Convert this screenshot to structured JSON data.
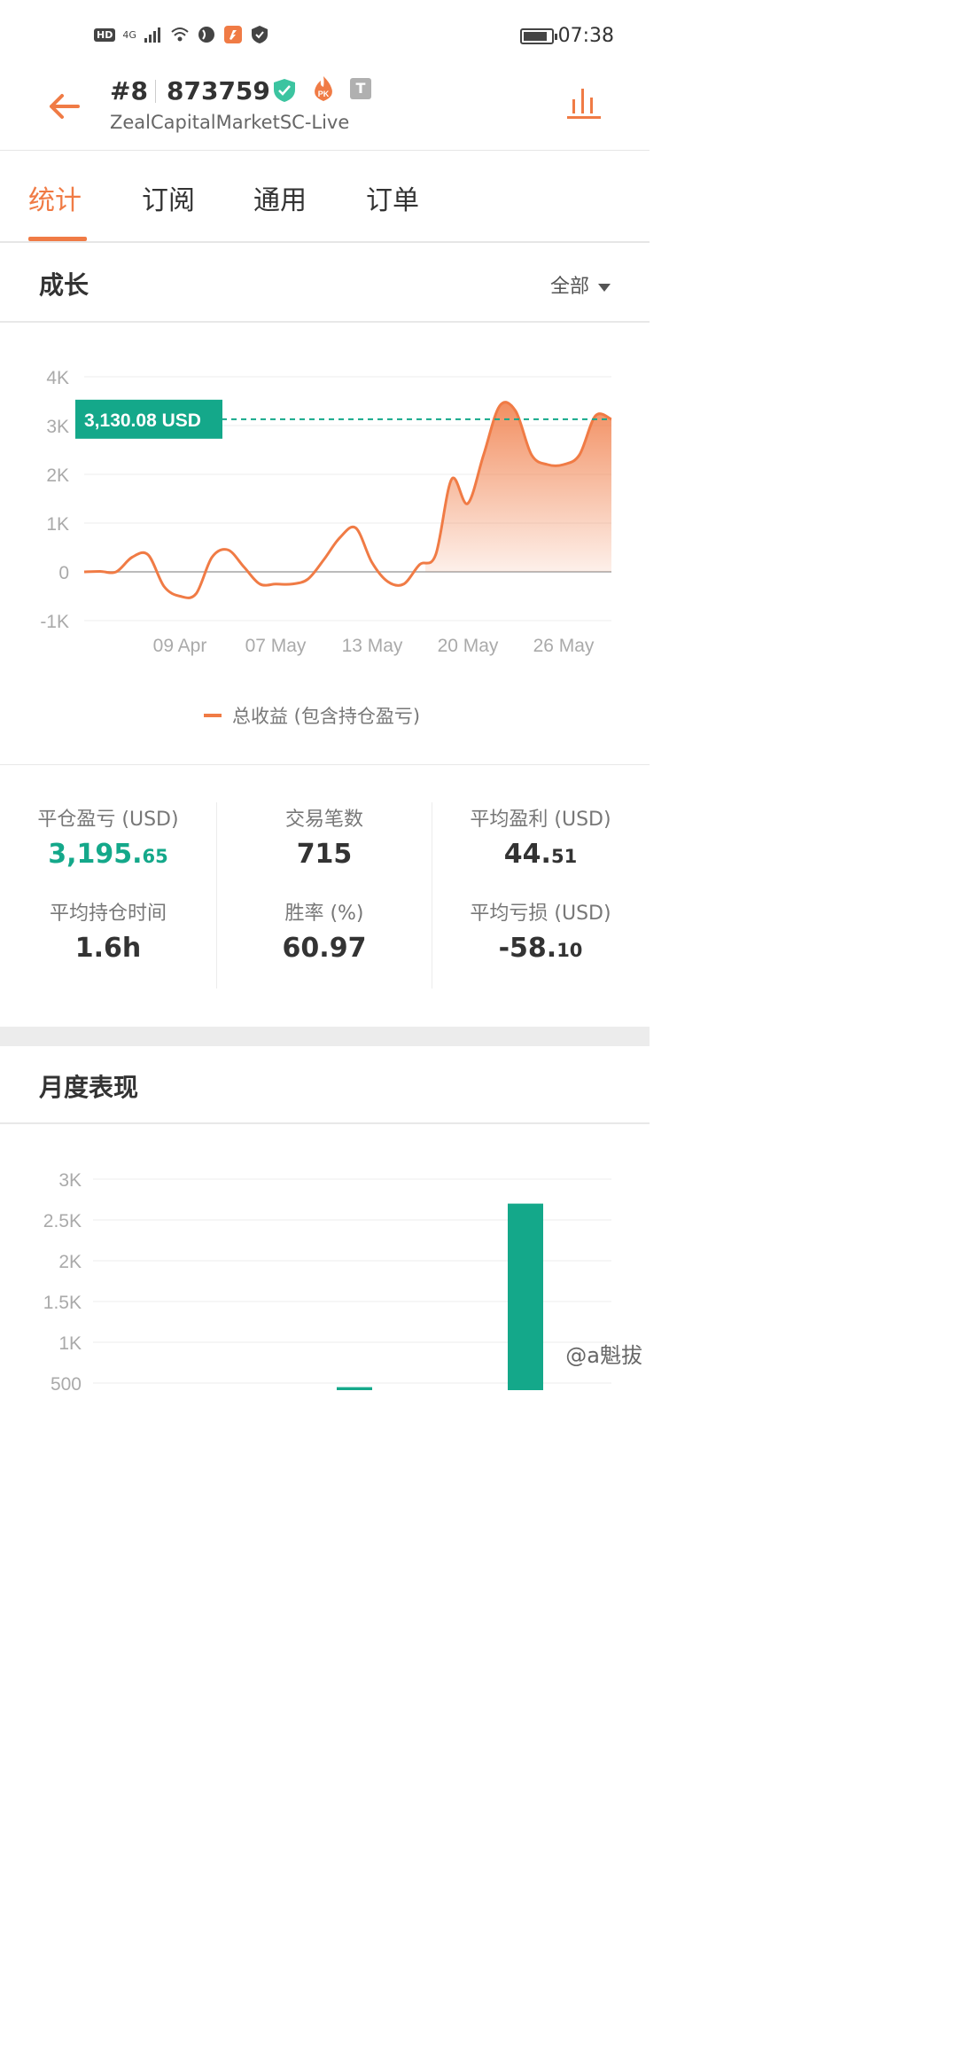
{
  "status_bar": {
    "hd": "HD",
    "network": "4G",
    "time": "07:38",
    "battery_level": 0.85
  },
  "header": {
    "rank": "#8",
    "account_number": "873759",
    "server": "ZealCapitalMarketSC-Live",
    "badge_pk": "PK",
    "badge_t": "T"
  },
  "tabs": [
    {
      "label": "统计",
      "active": true
    },
    {
      "label": "订阅",
      "active": false
    },
    {
      "label": "通用",
      "active": false
    },
    {
      "label": "订单",
      "active": false
    }
  ],
  "growth": {
    "title": "成长",
    "filter_label": "全部",
    "current_value_label": "3,130.08 USD",
    "legend": "总收益 (包含持仓盈亏)"
  },
  "chart_data": [
    {
      "type": "area",
      "y_ticks": [
        "4K",
        "3K",
        "2K",
        "1K",
        "0",
        "-1K"
      ],
      "x_ticks": [
        "09 Apr",
        "07 May",
        "13 May",
        "20 May",
        "26 May"
      ],
      "ylim": [
        -1000,
        4000
      ],
      "series": [
        {
          "name": "总收益 (包含持仓盈亏)",
          "color": "#f07b45",
          "values": [
            0,
            10,
            0,
            300,
            350,
            -300,
            -500,
            -450,
            300,
            450,
            100,
            -250,
            -250,
            -250,
            -150,
            250,
            700,
            900,
            200,
            -200,
            -250,
            150,
            350,
            1900,
            1400,
            2400,
            3400,
            3300,
            2400,
            2200,
            2200,
            2400,
            3200,
            3130
          ]
        }
      ],
      "reference_line": 3130.08,
      "legend_position": "bottom"
    },
    {
      "type": "bar",
      "y_ticks": [
        "3K",
        "2.5K",
        "2K",
        "1.5K",
        "1K",
        "500"
      ],
      "ylim": [
        0,
        3000
      ],
      "series": [
        {
          "color": "#14a88a",
          "values": [
            0,
            0,
            0,
            0,
            450,
            0,
            2700
          ]
        }
      ]
    }
  ],
  "stats": [
    {
      "label": "平仓盈亏 (USD)",
      "int": "3,195.",
      "dec": "65",
      "green": true
    },
    {
      "label": "交易笔数",
      "int": "715",
      "dec": "",
      "green": false
    },
    {
      "label": "平均盈利 (USD)",
      "int": "44.",
      "dec": "51",
      "green": false
    },
    {
      "label": "平均持仓时间",
      "int": "1.6h",
      "dec": "",
      "green": false
    },
    {
      "label": "胜率 (%)",
      "int": "60.97",
      "dec": "",
      "green": false
    },
    {
      "label": "平均亏损 (USD)",
      "int": "-58.",
      "dec": "10",
      "green": false
    }
  ],
  "monthly": {
    "title": "月度表现"
  },
  "watermark": "@a魁拔"
}
